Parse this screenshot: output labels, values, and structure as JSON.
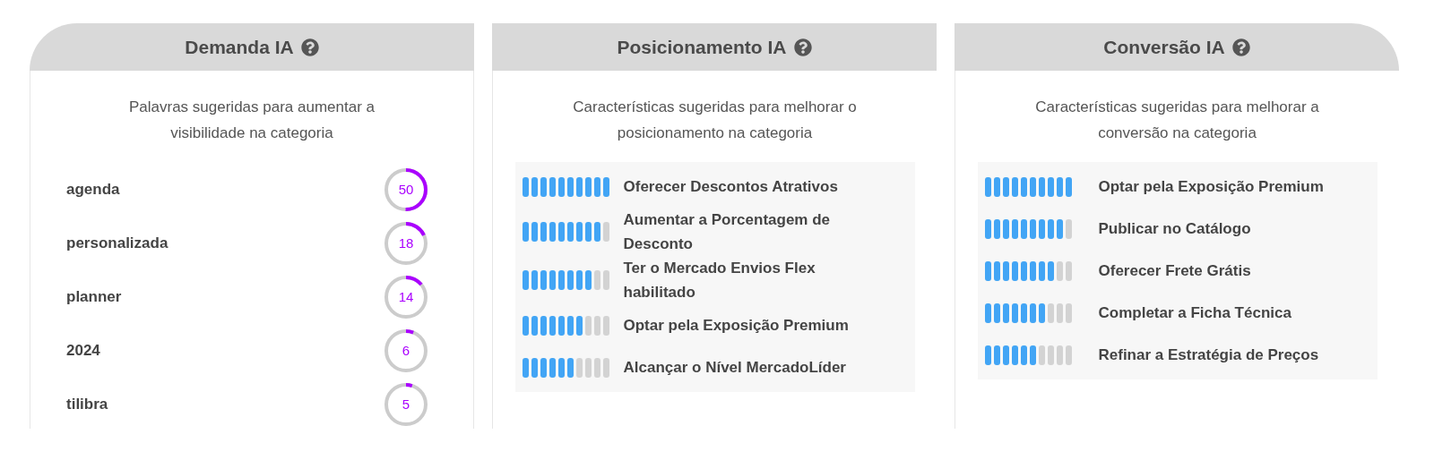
{
  "panels": [
    {
      "title": "Demanda IA",
      "kind": "keywords",
      "description": "Palavras sugeridas para aumentar a visibilidade na categoria",
      "items": [
        {
          "label": "agenda",
          "value": "50"
        },
        {
          "label": "personalizada",
          "value": "18"
        },
        {
          "label": "planner",
          "value": "14"
        },
        {
          "label": "2024",
          "value": "6"
        },
        {
          "label": "tilibra",
          "value": "5"
        }
      ]
    },
    {
      "title": "Posicionamento IA",
      "kind": "bars",
      "description": "Características sugeridas para melhorar o posicionamento na categoria",
      "items": [
        {
          "label": "Oferecer Descontos Atrativos",
          "level": 1
        },
        {
          "label": "Aumentar a Porcentagem de Desconto",
          "level": 0.9
        },
        {
          "label": "Ter o Mercado Envios Flex habilitado",
          "level": 0.8
        },
        {
          "label": "Optar pela Exposição Premium",
          "level": 0.7
        },
        {
          "label": "Alcançar o Nível MercadoLíder",
          "level": 0.6
        }
      ]
    },
    {
      "title": "Conversão IA",
      "kind": "bars",
      "description": "Características sugeridas para melhorar a conversão na categoria",
      "items": [
        {
          "label": "Optar pela Exposição Premium",
          "level": 1
        },
        {
          "label": "Publicar no Catálogo",
          "level": 0.9
        },
        {
          "label": "Oferecer Frete Grátis",
          "level": 0.8
        },
        {
          "label": "Completar a Ficha Técnica",
          "level": 0.7
        },
        {
          "label": "Refinar a Estratégia de Preços",
          "level": 0.6
        }
      ]
    }
  ]
}
